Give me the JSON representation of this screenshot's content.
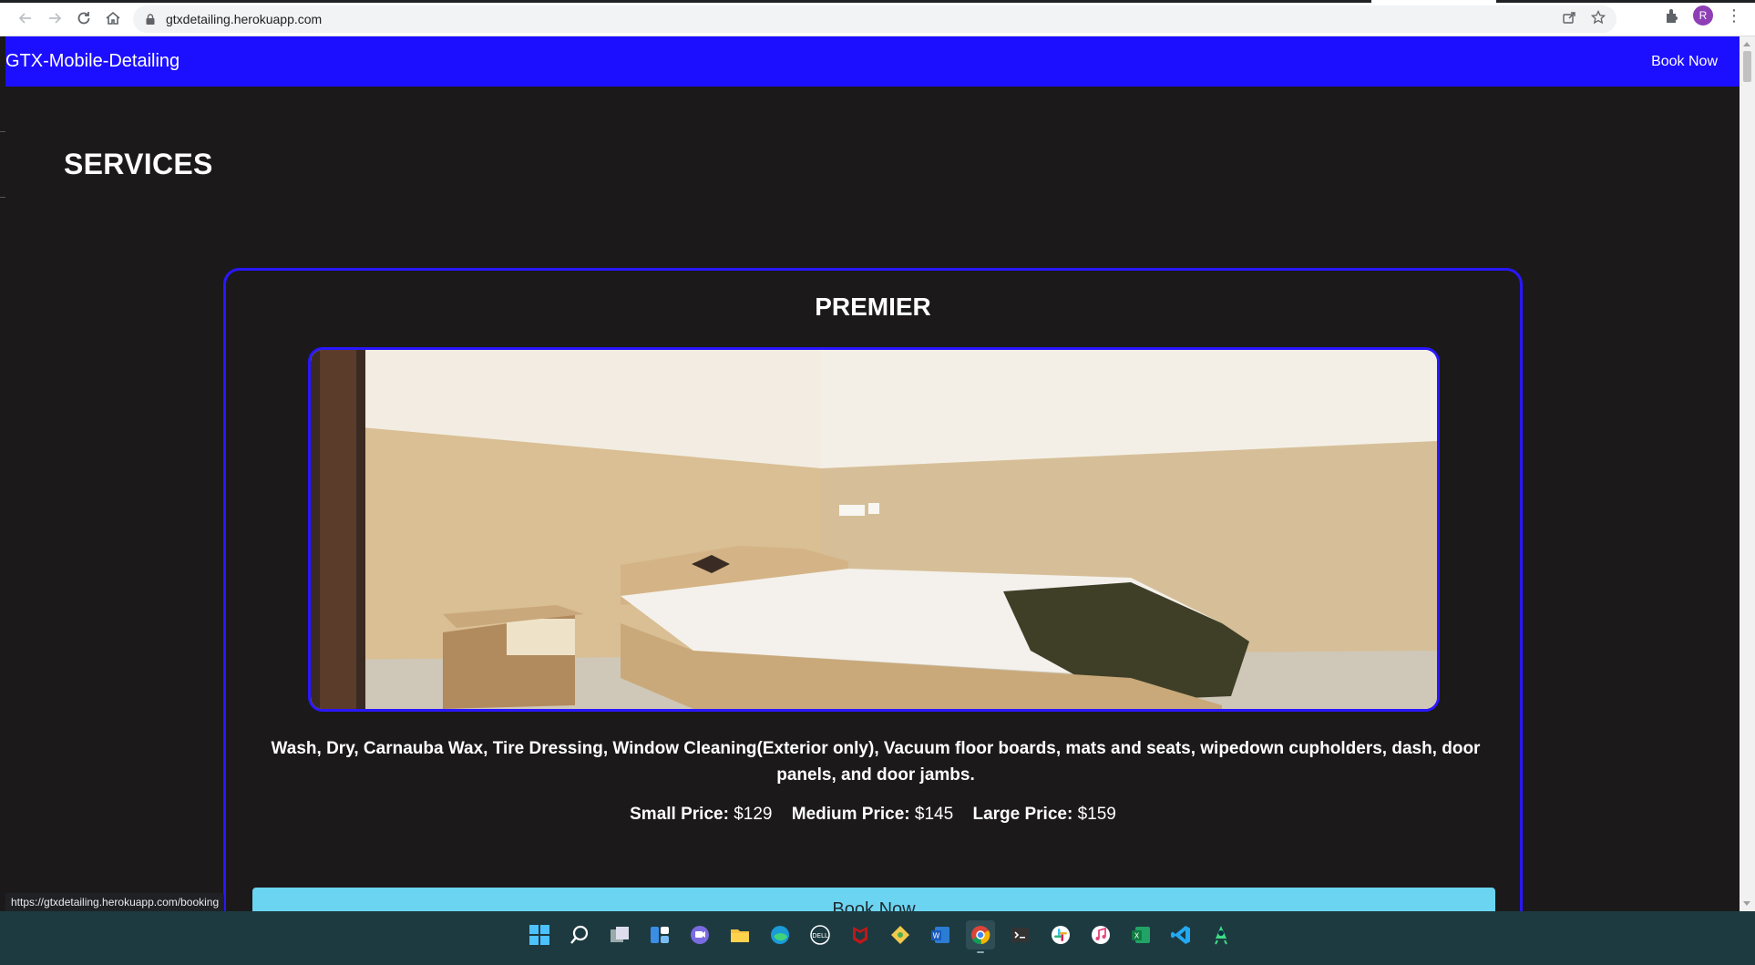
{
  "browser": {
    "url": "gtxdetailing.herokuapp.com",
    "avatar_initial": "R",
    "status_url": "https://gtxdetailing.herokuapp.com/booking"
  },
  "navbar": {
    "brand": "GTX-Mobile-Detailing",
    "book_link": "Book Now",
    "color": "#1c0fff"
  },
  "page": {
    "title": "SERVICES"
  },
  "card": {
    "title": "PREMIER",
    "description": "Wash, Dry, Carnauba Wax, Tire Dressing, Window Cleaning(Exterior only), Vacuum floor boards, mats and seats, wipedown cupholders, dash, door panels, and door jambs.",
    "prices": [
      {
        "label": "Small Price:",
        "value": "$129"
      },
      {
        "label": "Medium Price:",
        "value": "$145"
      },
      {
        "label": "Large Price:",
        "value": "$159"
      }
    ],
    "button_label": "Book Now",
    "border_color": "#2a17ff",
    "button_color": "#6bd4f1"
  },
  "taskbar": {
    "icons": [
      "windows-start-icon",
      "search-icon",
      "task-view-icon",
      "widgets-icon",
      "teams-chat-icon",
      "file-explorer-icon",
      "edge-icon",
      "dell-icon",
      "mcafee-icon",
      "git-icon",
      "word-icon",
      "chrome-icon",
      "terminal-icon",
      "slack-icon",
      "itunes-icon",
      "excel-icon",
      "vscode-icon",
      "android-studio-icon"
    ]
  }
}
